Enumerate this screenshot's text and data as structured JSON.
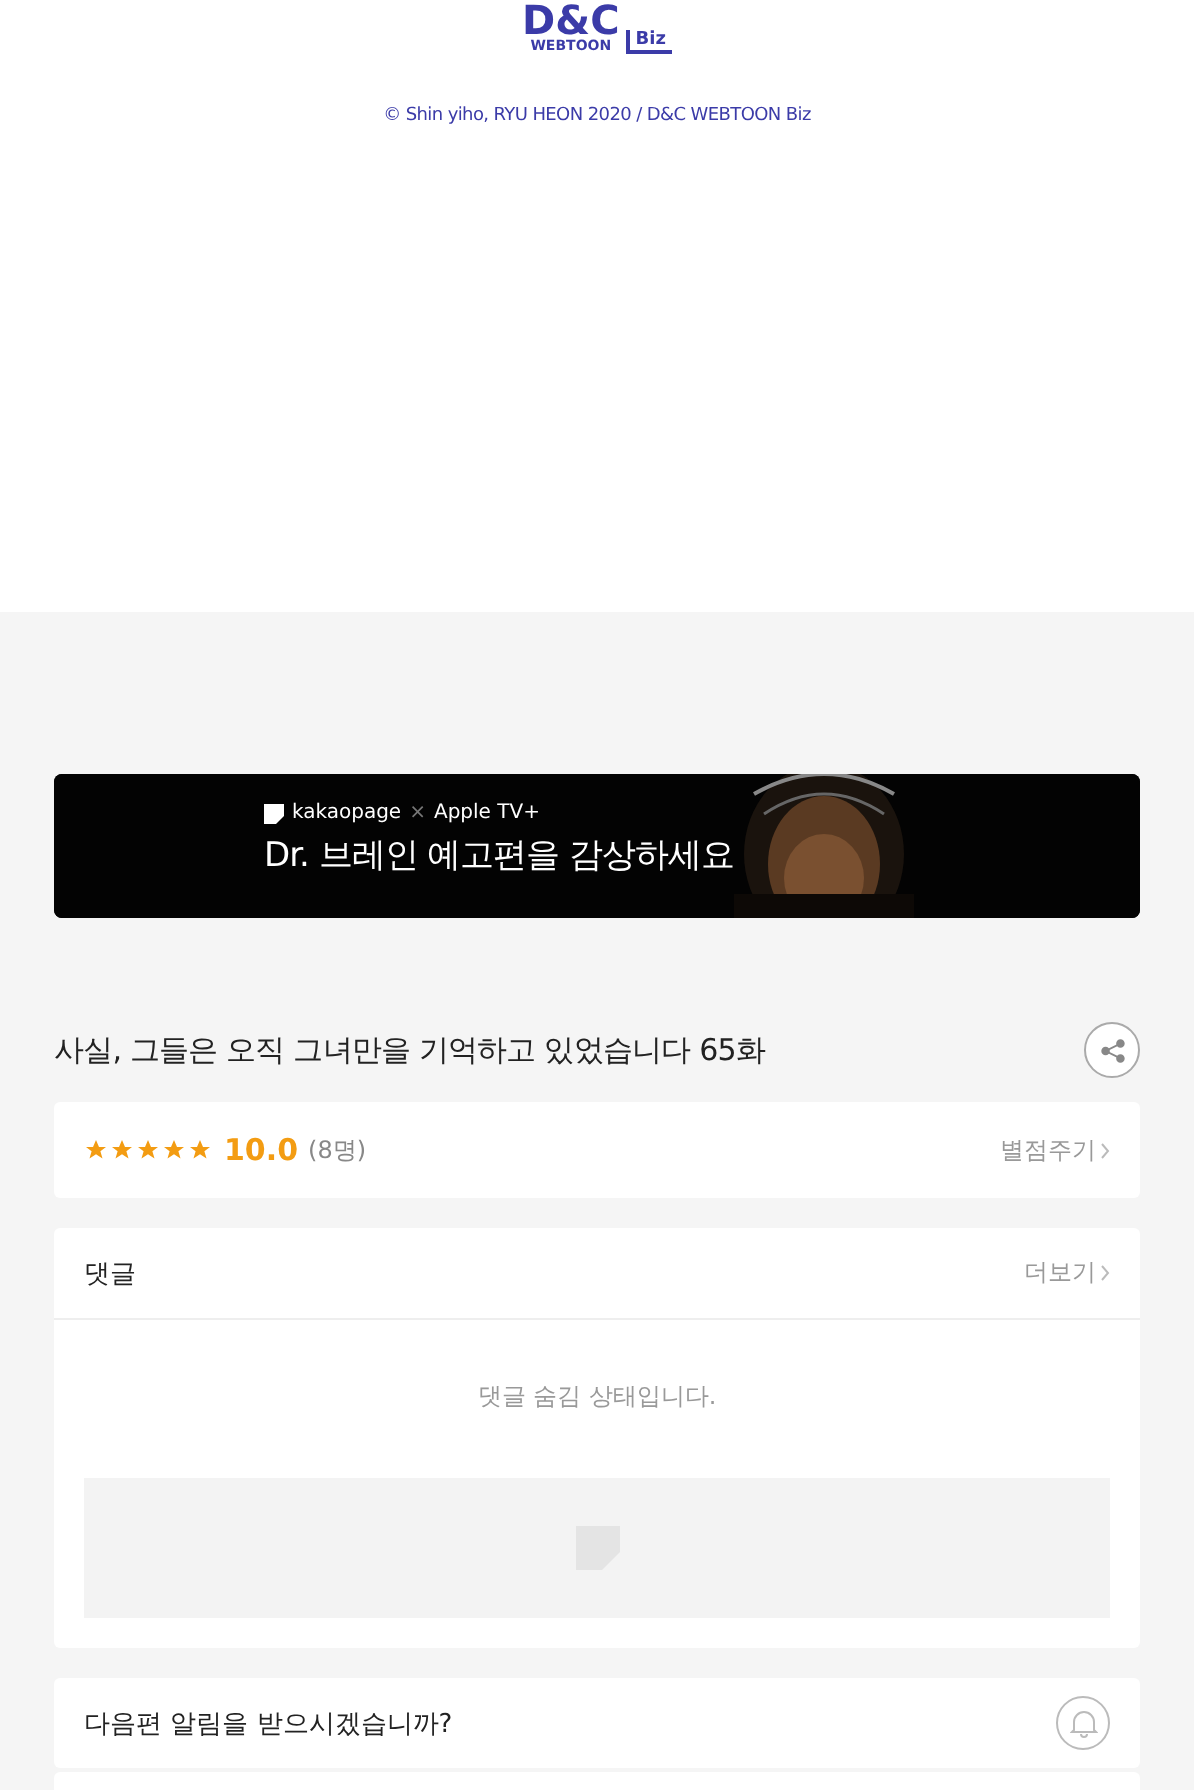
{
  "logo": {
    "main": "D&C",
    "sub": "WEBTOON",
    "badge": "Biz"
  },
  "copyright": "© Shin yiho, RYU HEON 2020 / D&C WEBTOON Biz",
  "banner": {
    "kind": "picture",
    "brand": "kakaopage",
    "separator": "×",
    "partner": "Apple TV+",
    "headline": "Dr. 브레인 예고편을 감상하세요"
  },
  "episode_title": "사실, 그들은 오직 그녀만을 기억하고 있었습니다 65화",
  "rating": {
    "stars": 5,
    "score": "10.0",
    "count": "(8명)",
    "action": "별점주기"
  },
  "comments": {
    "title": "댓글",
    "more": "더보기",
    "message": "댓글 숨김 상태입니다."
  },
  "notification": {
    "question": "다음편 알림을 받으시겠습니까?",
    "on": false
  }
}
